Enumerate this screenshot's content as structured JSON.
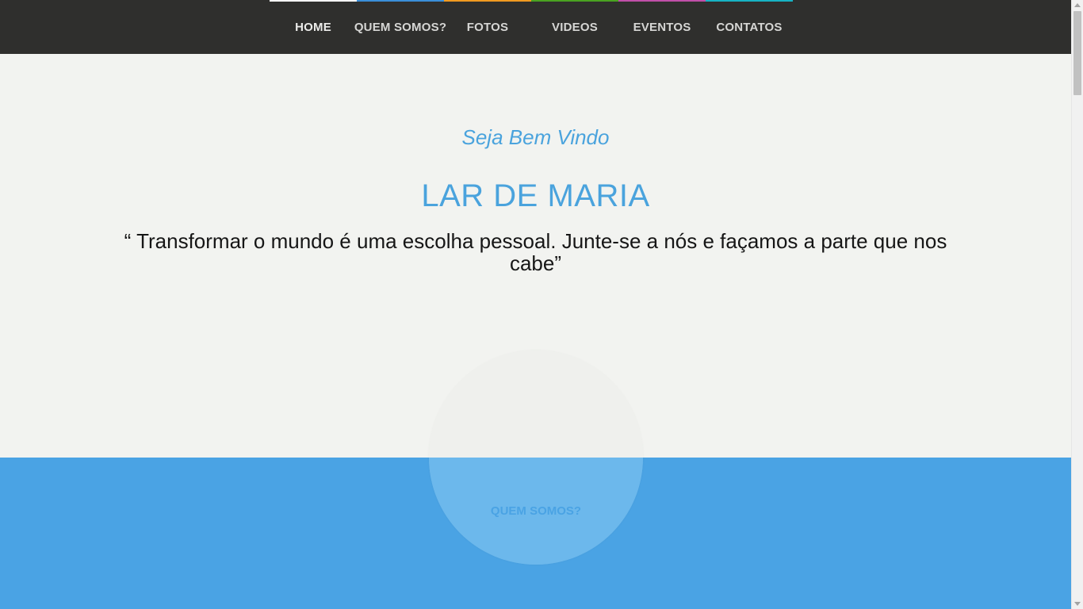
{
  "nav": {
    "items": [
      {
        "label": "HOME",
        "color": "#ffffff",
        "active": true
      },
      {
        "label": "QUEM SOMOS?",
        "color": "#3a8fd9"
      },
      {
        "label": "FOTOS",
        "color": "#f19a21"
      },
      {
        "label": "VIDEOS",
        "color": "#4aa321"
      },
      {
        "label": "EVENTOS",
        "color": "#c04fa8"
      },
      {
        "label": "CONTATOS",
        "color": "#17b3c4"
      }
    ]
  },
  "hero": {
    "welcome": "Seja Bem Vindo",
    "title": "LAR DE MARIA",
    "quote": "“ Transformar o mundo é uma escolha pessoal. Junte-se a nós e façamos a parte que nos cabe”"
  },
  "circle_link": {
    "label": "QUEM SOMOS?"
  },
  "colors": {
    "accent": "#4aa3dd",
    "section_blue": "#4aa3e4",
    "nav_bg": "#2f2f2d",
    "page_bg": "#f2f3f0"
  }
}
